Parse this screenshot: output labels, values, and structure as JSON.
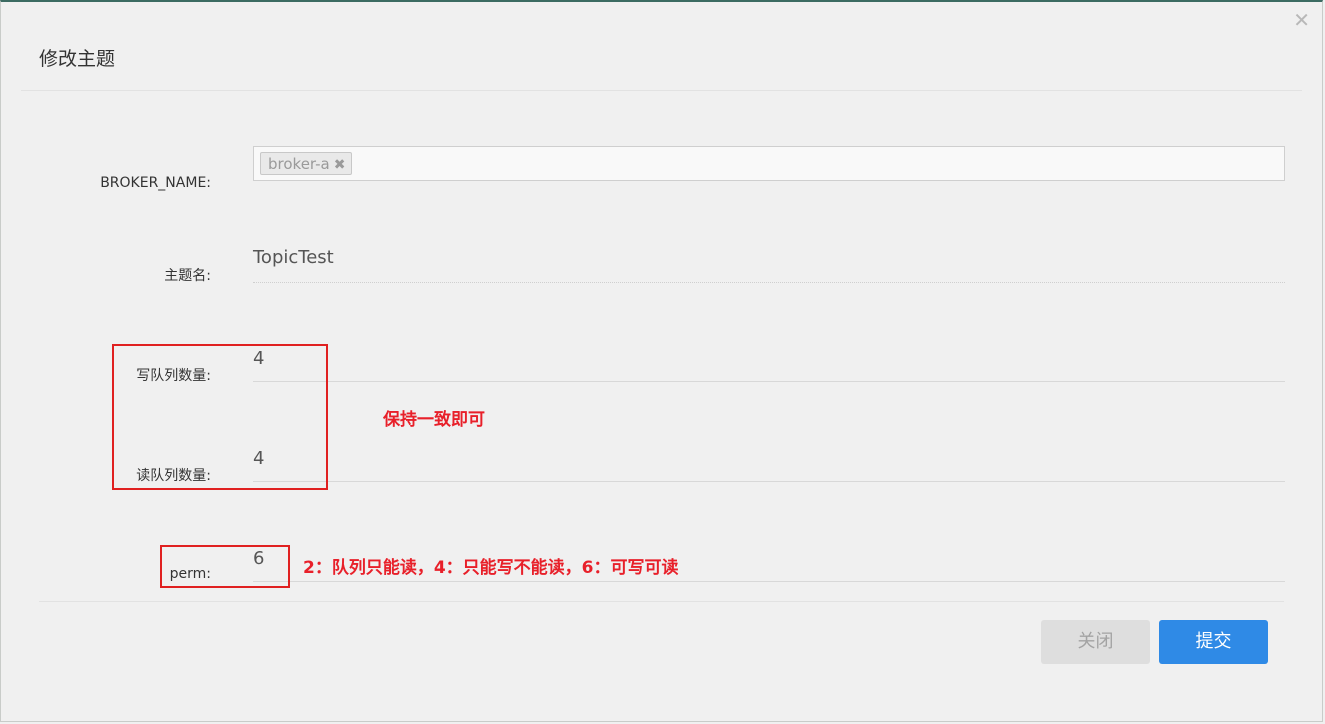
{
  "dialog": {
    "title": "修改主题",
    "close_symbol": "✕"
  },
  "form": {
    "broker_name": {
      "label": "BROKER_NAME:",
      "tags": [
        "broker-a"
      ],
      "tag_remove_symbol": "✖"
    },
    "topic_name": {
      "label": "主题名:",
      "value": "TopicTest"
    },
    "write_queue": {
      "label": "写队列数量:",
      "value": "4"
    },
    "read_queue": {
      "label": "读队列数量:",
      "value": "4"
    },
    "perm": {
      "label": "perm:",
      "value": "6"
    }
  },
  "annotations": {
    "queue_note": "保持一致即可",
    "perm_note": "2：队列只能读，4：只能写不能读，6：可写可读",
    "color": "#e8202a"
  },
  "footer": {
    "close_label": "关闭",
    "submit_label": "提交"
  },
  "colors": {
    "primary": "#2f8ae6",
    "disabled": "#dedede"
  },
  "icons": {
    "close": "close-icon",
    "tag_remove": "tag-remove-icon"
  }
}
